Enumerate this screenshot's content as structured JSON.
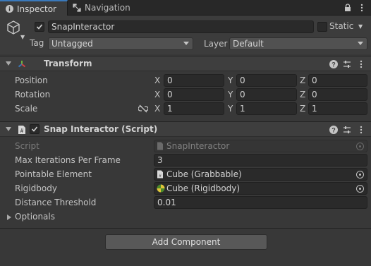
{
  "tabs": {
    "inspector": "Inspector",
    "navigation": "Navigation",
    "right_icons": [
      "lock-icon",
      "kebab-menu-icon"
    ]
  },
  "header": {
    "active": true,
    "name": "SnapInteractor",
    "static_label": "Static",
    "static_checked": false,
    "tag_label": "Tag",
    "tag_value": "Untagged",
    "layer_label": "Layer",
    "layer_value": "Default"
  },
  "transform": {
    "title": "Transform",
    "rows": [
      {
        "label": "Position",
        "x": "0",
        "y": "0",
        "z": "0"
      },
      {
        "label": "Rotation",
        "x": "0",
        "y": "0",
        "z": "0"
      },
      {
        "label": "Scale",
        "x": "1",
        "y": "1",
        "z": "1"
      }
    ],
    "axis_labels": {
      "x": "X",
      "y": "Y",
      "z": "Z"
    }
  },
  "snap": {
    "title": "Snap Interactor (Script)",
    "enabled": true,
    "script_label": "Script",
    "script_value": "SnapInteractor",
    "max_iter_label": "Max Iterations Per Frame",
    "max_iter_value": "3",
    "pointable_label": "Pointable Element",
    "pointable_value": "Cube (Grabbable)",
    "rigidbody_label": "Rigidbody",
    "rigidbody_value": "Cube (Rigidbody)",
    "distance_label": "Distance Threshold",
    "distance_value": "0.01",
    "optionals_label": "Optionals"
  },
  "add_component": "Add Component",
  "colors": {
    "accent": "#3a79bb",
    "panel": "#383838",
    "header": "#3e3e3e",
    "field": "#2a2a2a"
  }
}
